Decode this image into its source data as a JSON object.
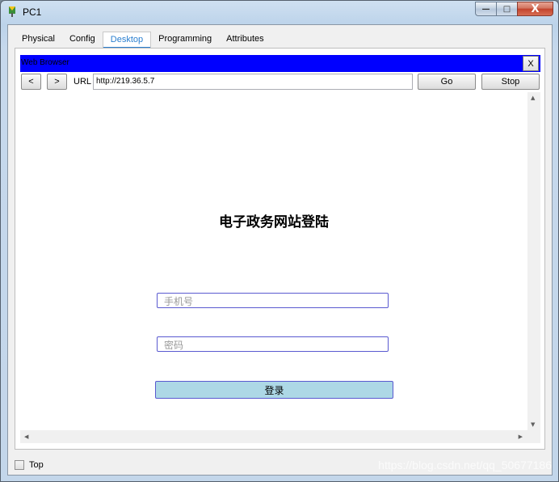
{
  "window": {
    "title": "PC1",
    "minimize_label": "—",
    "maximize_label": "□",
    "close_label": "X"
  },
  "tabs": [
    {
      "label": "Physical"
    },
    {
      "label": "Config"
    },
    {
      "label": "Desktop",
      "active": true
    },
    {
      "label": "Programming"
    },
    {
      "label": "Attributes"
    }
  ],
  "browser": {
    "title": "Web Browser",
    "close_label": "X",
    "back_label": "<",
    "forward_label": ">",
    "url_label": "URL",
    "url_value": "http://219.36.5.7",
    "go_label": "Go",
    "stop_label": "Stop"
  },
  "page": {
    "heading": "电子政务网站登陆",
    "phone_placeholder": "手机号",
    "password_placeholder": "密码",
    "login_label": "登录"
  },
  "footer": {
    "top_label": "Top"
  },
  "watermark": "https://blog.csdn.net/qq_50677186",
  "colors": {
    "browser_bar": "#0000ff",
    "login_button": "#add8e6",
    "active_tab": "#2a7fd0"
  }
}
